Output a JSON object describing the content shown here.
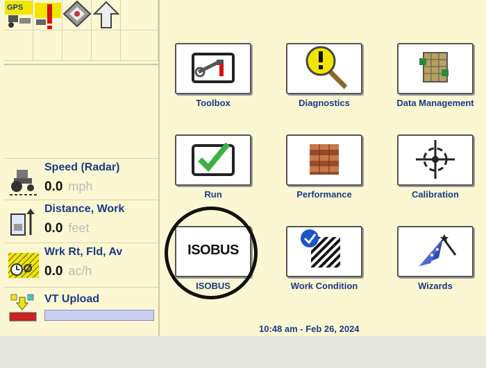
{
  "status_bar": {
    "gps_label": "GPS"
  },
  "gauges": [
    {
      "label": "Speed (Radar)",
      "value": "0.0",
      "unit": "mph",
      "icon": "tractor-speed-icon"
    },
    {
      "label": "Distance, Work",
      "value": "0.0",
      "unit": "feet",
      "icon": "distance-icon"
    },
    {
      "label": "Wrk Rt, Fld, Av",
      "value": "0.0",
      "unit": "ac/h",
      "icon": "work-rate-icon"
    }
  ],
  "vt_upload": {
    "label": "VT Upload",
    "progress": 0
  },
  "menu": [
    {
      "label": "Toolbox",
      "icon": "toolbox-icon"
    },
    {
      "label": "Diagnostics",
      "icon": "diagnostics-icon"
    },
    {
      "label": "Data Management",
      "icon": "data-management-icon"
    },
    {
      "label": "Run",
      "icon": "run-checkmark-icon"
    },
    {
      "label": "Performance",
      "icon": "performance-icon"
    },
    {
      "label": "Calibration",
      "icon": "calibration-crosshair-icon"
    },
    {
      "label": "ISOBUS",
      "icon": "isobus-icon",
      "icon_text": "ISOBUS"
    },
    {
      "label": "Work Condition",
      "icon": "work-condition-icon"
    },
    {
      "label": "Wizards",
      "icon": "wizard-hat-icon"
    }
  ],
  "datetime": "10:48 am - Feb 26, 2024",
  "colors": {
    "background": "#fbf7d2",
    "label_blue": "#1a3a86",
    "gps_yellow": "#f2e600",
    "check_green": "#3cb043",
    "progress_fill": "#c9cdf0"
  }
}
